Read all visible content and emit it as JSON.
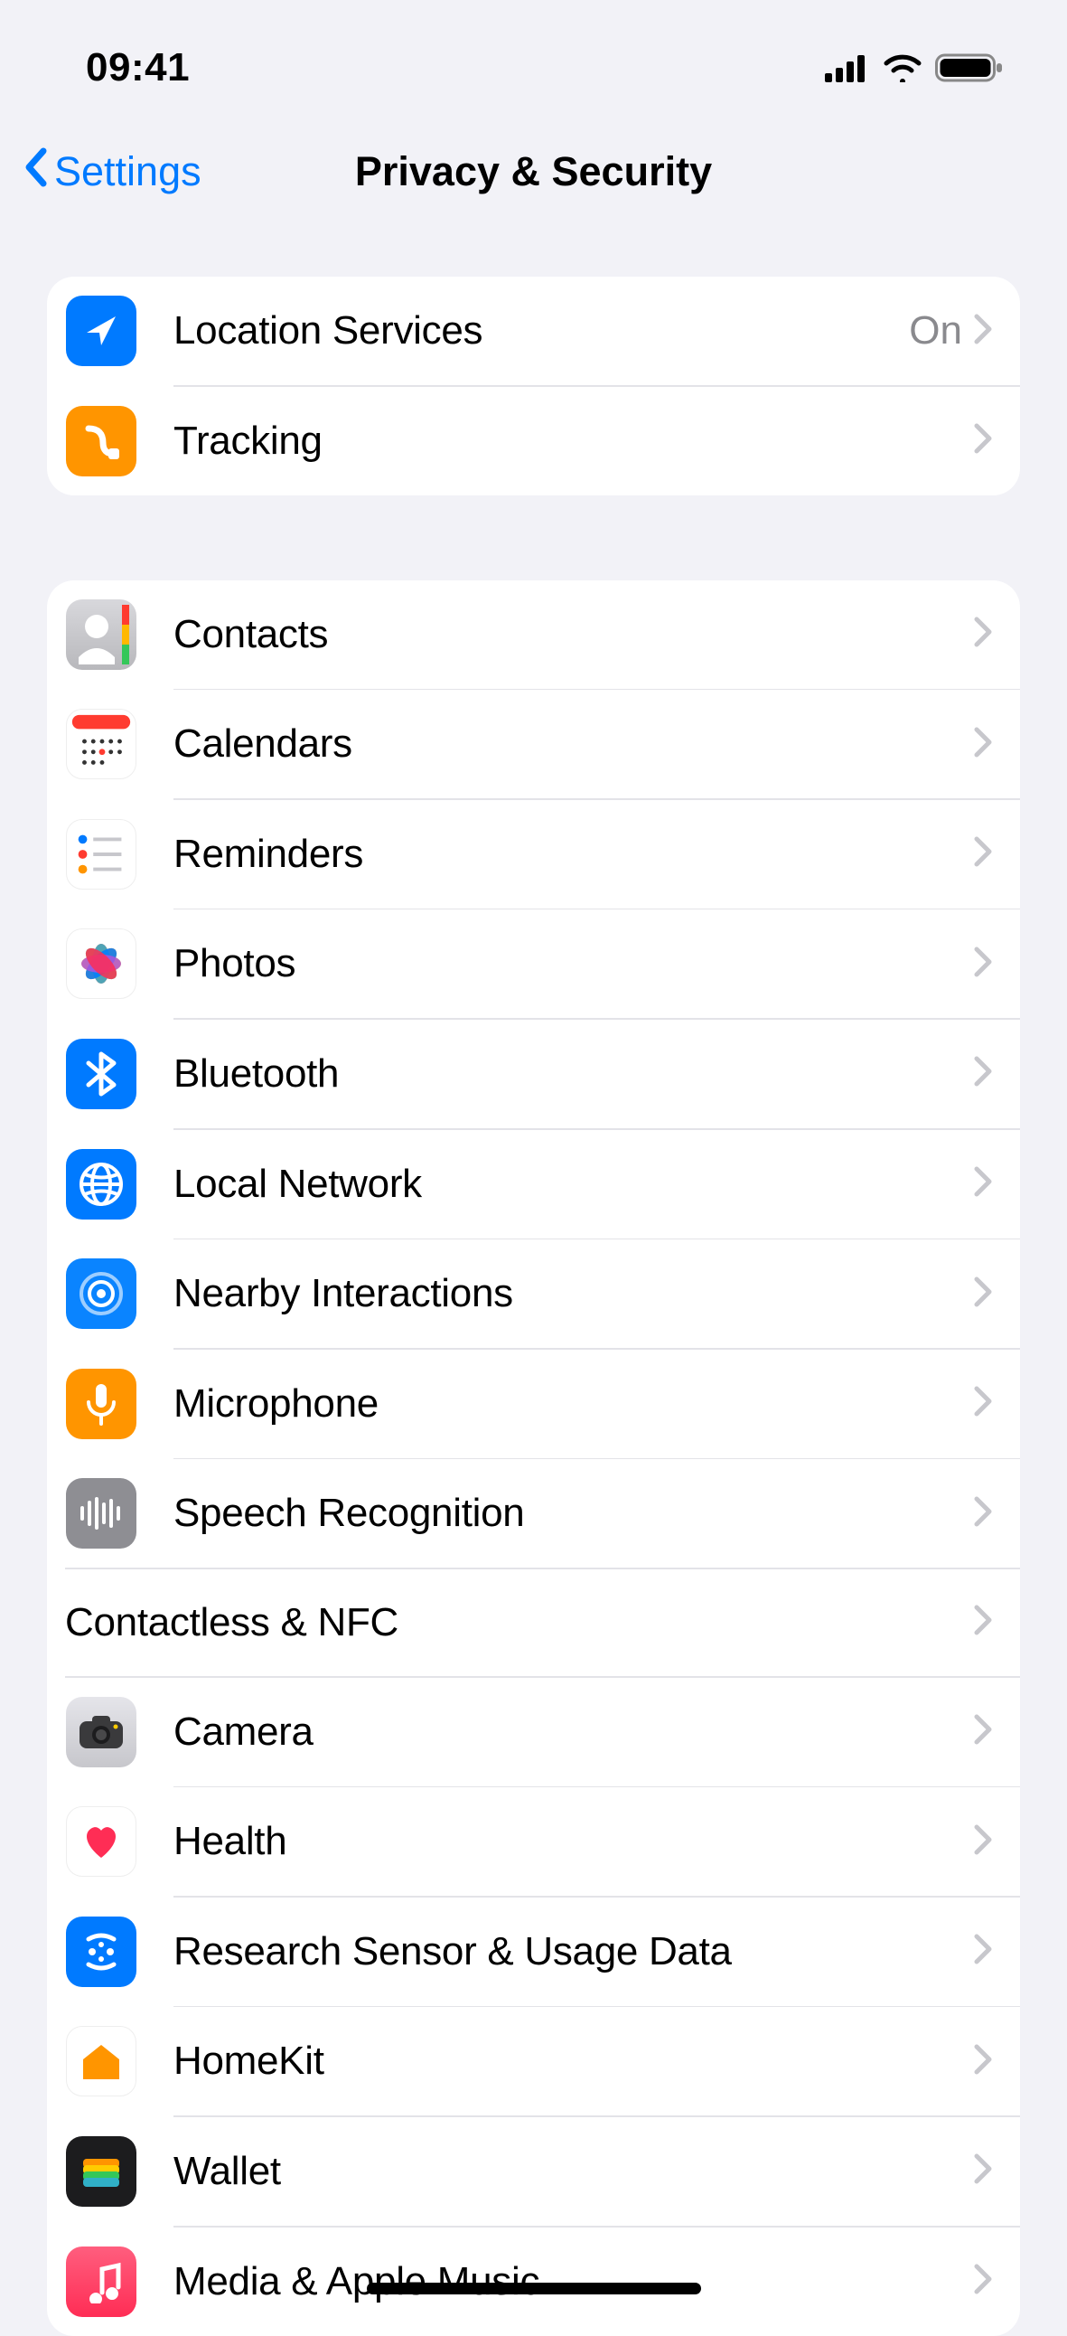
{
  "status": {
    "time": "09:41"
  },
  "nav": {
    "back": "Settings",
    "title": "Privacy & Security"
  },
  "group1": [
    {
      "label": "Location Services",
      "value": "On",
      "icon": "location",
      "bg": "#007aff"
    },
    {
      "label": "Tracking",
      "icon": "tracking",
      "bg": "#ff9500"
    }
  ],
  "group2": [
    {
      "label": "Contacts",
      "icon": "contacts"
    },
    {
      "label": "Calendars",
      "icon": "calendars"
    },
    {
      "label": "Reminders",
      "icon": "reminders"
    },
    {
      "label": "Photos",
      "icon": "photos"
    },
    {
      "label": "Bluetooth",
      "icon": "bluetooth",
      "bg": "#007aff"
    },
    {
      "label": "Local Network",
      "icon": "localnetwork",
      "bg": "#007aff"
    },
    {
      "label": "Nearby Interactions",
      "icon": "nearby",
      "bg": "#0a84ff"
    },
    {
      "label": "Microphone",
      "icon": "microphone",
      "bg": "#ff9500"
    },
    {
      "label": "Speech Recognition",
      "icon": "speech",
      "bg": "#8e8e93"
    },
    {
      "label": "Contactless & NFC",
      "noicon": true
    },
    {
      "label": "Camera",
      "icon": "camera"
    },
    {
      "label": "Health",
      "icon": "health"
    },
    {
      "label": "Research Sensor & Usage Data",
      "icon": "research",
      "bg": "#007aff"
    },
    {
      "label": "HomeKit",
      "icon": "homekit"
    },
    {
      "label": "Wallet",
      "icon": "wallet"
    },
    {
      "label": "Media & Apple Music",
      "icon": "music",
      "bg": "#ff2d55"
    }
  ]
}
